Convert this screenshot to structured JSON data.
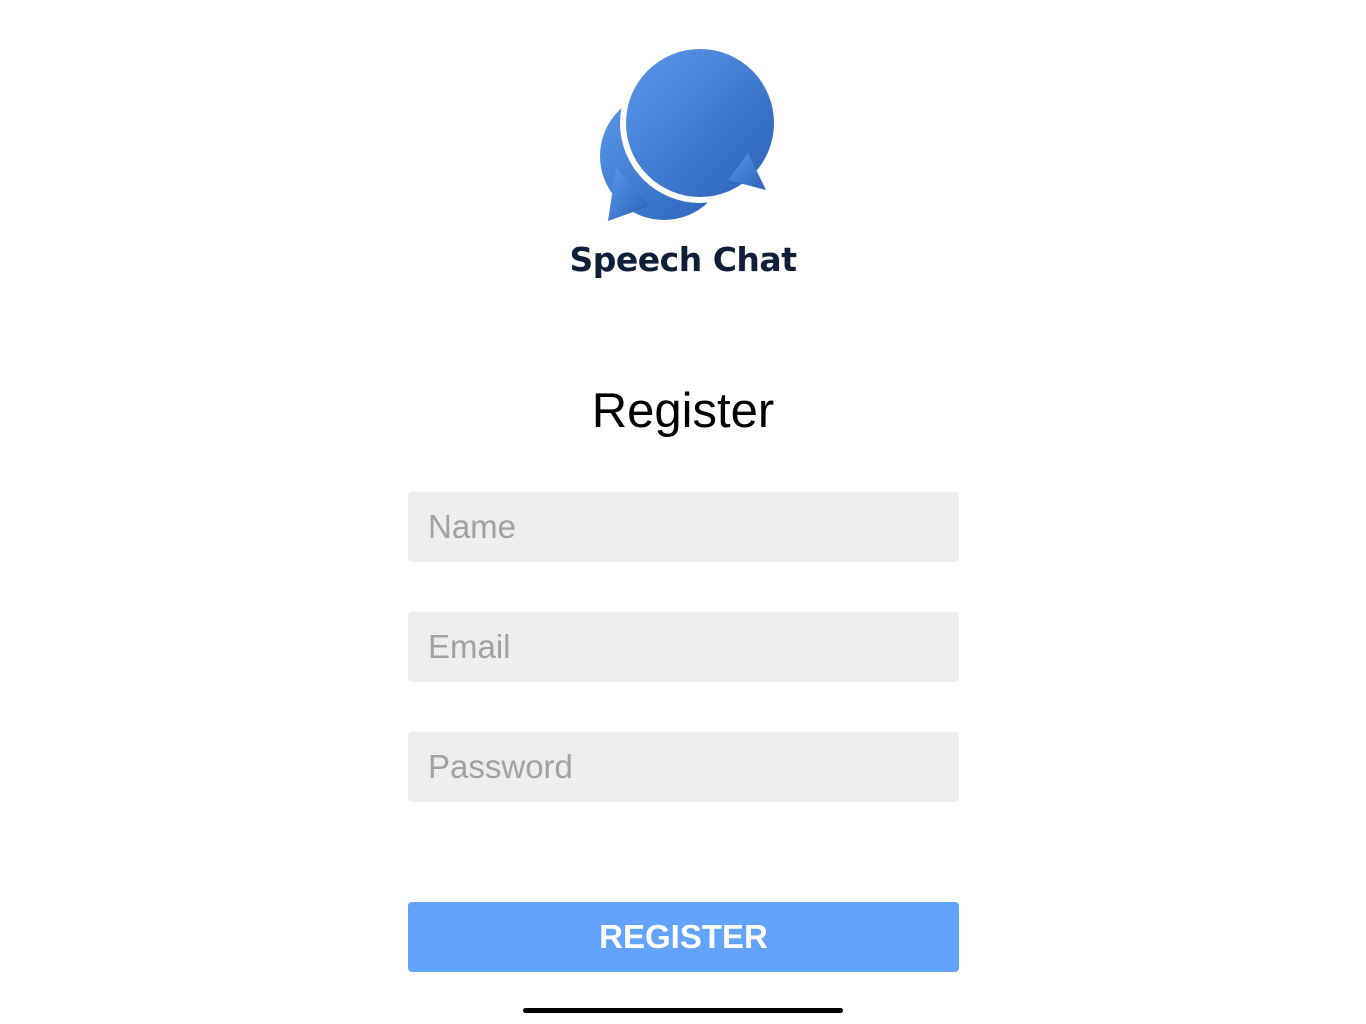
{
  "app": {
    "brand_name": "Speech Chat",
    "logo_icon": "speech-bubbles-icon",
    "brand_text_color": "#0f1f3a",
    "logo_gradient": [
      "#5a98ea",
      "#2a62b8"
    ]
  },
  "form": {
    "title": "Register",
    "name_placeholder": "Name",
    "name_value": "",
    "email_placeholder": "Email",
    "email_value": "",
    "password_placeholder": "Password",
    "password_value": "",
    "field_background": "#eeeeee",
    "register_label": "REGISTER",
    "register_color": "#62a3fc"
  }
}
